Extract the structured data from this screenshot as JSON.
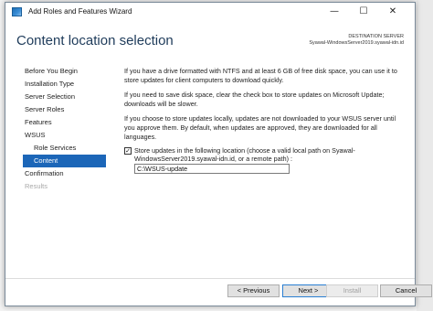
{
  "window": {
    "title": "Add Roles and Features Wizard",
    "controls": {
      "minimize": "—",
      "maximize": "☐",
      "close": "✕"
    }
  },
  "header": {
    "page_title": "Content location selection",
    "destination_label": "DESTINATION SERVER",
    "destination_server": "Syawal-WindowsServer2019.syawal-idn.id"
  },
  "nav": {
    "items": [
      {
        "label": "Before You Begin",
        "state": "normal"
      },
      {
        "label": "Installation Type",
        "state": "normal"
      },
      {
        "label": "Server Selection",
        "state": "normal"
      },
      {
        "label": "Server Roles",
        "state": "normal"
      },
      {
        "label": "Features",
        "state": "normal"
      },
      {
        "label": "WSUS",
        "state": "normal"
      },
      {
        "label": "Role Services",
        "state": "sub"
      },
      {
        "label": "Content",
        "state": "active"
      },
      {
        "label": "Confirmation",
        "state": "normal"
      },
      {
        "label": "Results",
        "state": "disabled"
      }
    ]
  },
  "content": {
    "para1": "If you have a drive formatted with NTFS and at least 6 GB of free disk space, you can use it to store updates for client computers to download quickly.",
    "para2": "If you need to save disk space, clear the check box to store updates on Microsoft Update; downloads will be slower.",
    "para3": "If you choose to store updates locally, updates are not downloaded to your WSUS server until you approve them. By default, when updates are approved, they are downloaded for all languages.",
    "store_checkbox_checked": true,
    "store_checkbox_label": "Store updates in the following location (choose a valid local path on Syawal-WindowsServer2019.syawal-idn.id, or a remote path) :",
    "path_value": "C:\\WSUS-update"
  },
  "footer": {
    "previous": "< Previous",
    "next": "Next >",
    "install": "Install",
    "cancel": "Cancel"
  }
}
